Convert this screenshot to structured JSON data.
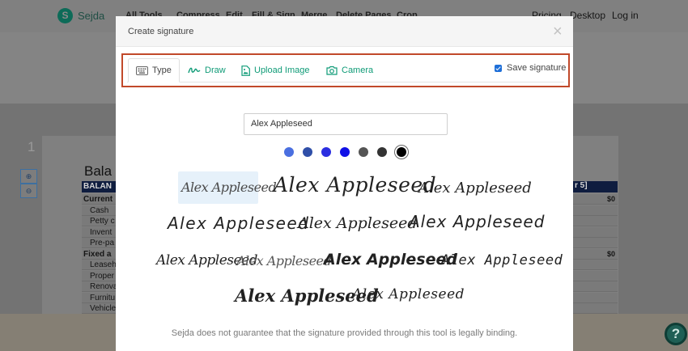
{
  "app": {
    "brand": "Sejda",
    "nav": [
      "All Tools",
      "Compress",
      "Edit",
      "Fill & Sign",
      "Merge",
      "Delete Pages",
      "Crop"
    ],
    "nav_right": [
      "Pricing",
      "Desktop",
      "Log in"
    ]
  },
  "background_doc": {
    "page_number": "1",
    "zoom_in": "⊕",
    "zoom_out": "⊖",
    "title": "Bala",
    "header_left": "BALAN",
    "header_right": "r 5]",
    "rows": [
      {
        "label": "Current",
        "bold": true,
        "value": "$0"
      },
      {
        "label": "Cash",
        "bold": false,
        "value": ""
      },
      {
        "label": "Petty c",
        "bold": false,
        "value": ""
      },
      {
        "label": "Invent",
        "bold": false,
        "value": ""
      },
      {
        "label": "Pre-pa",
        "bold": false,
        "value": ""
      },
      {
        "label": "Fixed a",
        "bold": true,
        "value": "$0"
      },
      {
        "label": "Leaseh",
        "bold": false,
        "value": ""
      },
      {
        "label": "Proper",
        "bold": false,
        "value": ""
      },
      {
        "label": "Renova",
        "bold": false,
        "value": ""
      },
      {
        "label": "Furnitu",
        "bold": false,
        "value": ""
      },
      {
        "label": "Vehicle",
        "bold": false,
        "value": ""
      }
    ],
    "help": "?"
  },
  "modal": {
    "title": "Create signature",
    "close": "×",
    "tabs": [
      {
        "label": "Type",
        "icon": "keyboard-icon",
        "active": true
      },
      {
        "label": "Draw",
        "icon": "pen-scribble-icon",
        "active": false
      },
      {
        "label": "Upload Image",
        "icon": "image-file-icon",
        "active": false
      },
      {
        "label": "Camera",
        "icon": "camera-icon",
        "active": false
      }
    ],
    "save_signature_label": "Save signature",
    "save_signature_checked": true,
    "name_value": "Alex Appleseed",
    "colors": [
      "#4a6fe0",
      "#2f4fa8",
      "#2b2ee0",
      "#1010e6",
      "#555555",
      "#333333",
      "#000000"
    ],
    "selected_color_index": 6,
    "signatures": [
      "Alex Appleseed",
      "Alex Appleseed",
      "Alex Appleseed",
      "Alex Appleseed",
      "Alex Appleseed",
      "Alex Appleseed",
      "Alex Appleseed",
      "Alex Appleseed",
      "Alex Appleseed",
      "Alex Appleseed",
      "Alex Appleseed",
      "Alex Appleseed"
    ],
    "disclaimer": "Sejda does not guarantee that the signature provided through this tool is legally binding."
  }
}
